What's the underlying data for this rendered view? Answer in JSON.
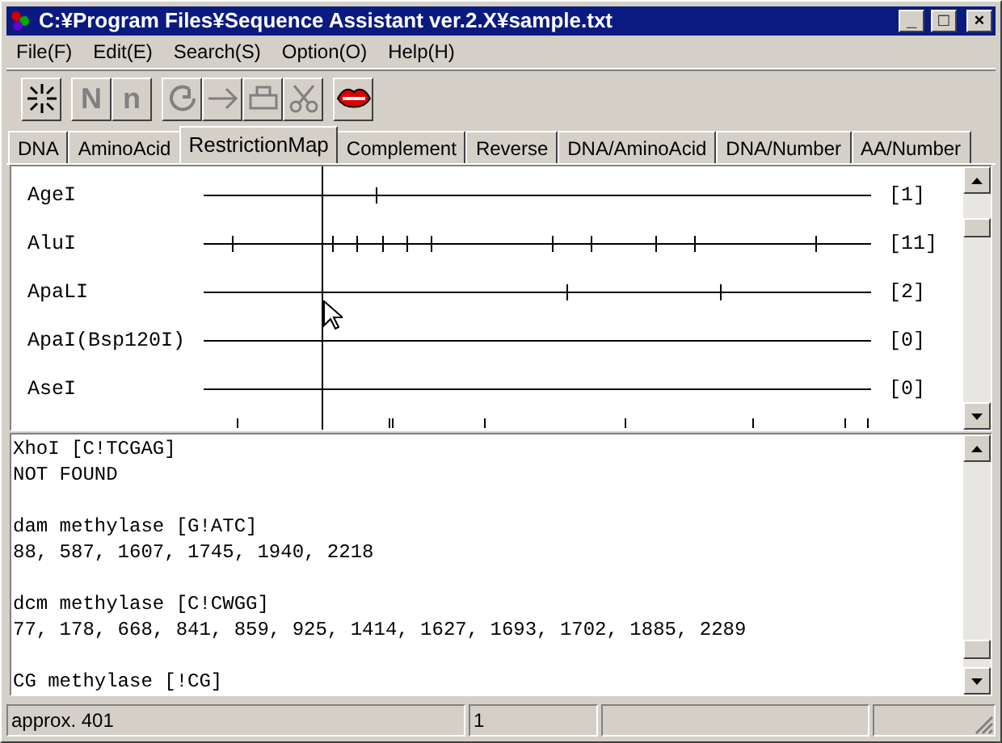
{
  "window": {
    "title": "C:¥Program Files¥Sequence Assistant ver.2.X¥sample.txt",
    "controls": [
      "_",
      "□",
      "×"
    ]
  },
  "menu": [
    "File(F)",
    "Edit(E)",
    "Search(S)",
    "Option(O)",
    "Help(H)"
  ],
  "toolbar": [
    {
      "kind": "sparkle",
      "disabled": false
    },
    {
      "kind": "letter",
      "label": "N",
      "disabled": true
    },
    {
      "kind": "letter",
      "label": "n",
      "disabled": true
    },
    {
      "kind": "rotate",
      "disabled": true
    },
    {
      "kind": "arrow",
      "disabled": true
    },
    {
      "kind": "printer",
      "disabled": true
    },
    {
      "kind": "scissors",
      "disabled": true
    },
    {
      "kind": "lips",
      "disabled": false
    }
  ],
  "tabs": [
    {
      "label": "DNA",
      "selected": false
    },
    {
      "label": "AminoAcid",
      "selected": false
    },
    {
      "label": "RestrictionMap",
      "selected": true
    },
    {
      "label": "Complement",
      "selected": false
    },
    {
      "label": "Reverse",
      "selected": false
    },
    {
      "label": "DNA/AminoAcid",
      "selected": false
    },
    {
      "label": "DNA/Number",
      "selected": false
    },
    {
      "label": "AA/Number",
      "selected": false
    }
  ],
  "restriction_map": [
    {
      "enzyme": "AgeI",
      "count": "[1]"
    },
    {
      "enzyme": "AluI",
      "count": "[11]"
    },
    {
      "enzyme": "ApaLI",
      "count": "[2]"
    },
    {
      "enzyme": "ApaI(Bsp120I)",
      "count": "[0]"
    },
    {
      "enzyme": "AseI",
      "count": "[0]"
    }
  ],
  "results": [
    {
      "lines": [
        "XhoI [C!TCGAG]",
        "NOT FOUND"
      ]
    },
    {
      "lines": [
        "dam methylase [G!ATC]",
        "88, 587, 1607, 1745, 1940, 2218"
      ]
    },
    {
      "lines": [
        "dcm methylase [C!CWGG]",
        "77, 178, 668, 841, 859, 925, 1414, 1627, 1693, 1702, 1885, 2289"
      ]
    },
    {
      "lines": [
        "CG methylase [!CG]"
      ]
    }
  ],
  "status_bar": [
    "approx. 401",
    "1"
  ]
}
